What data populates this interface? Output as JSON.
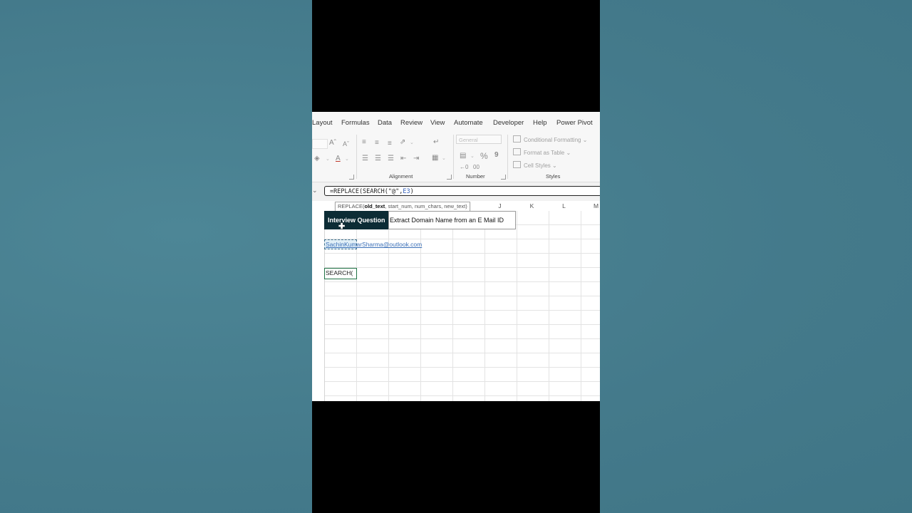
{
  "menu": {
    "tabs": [
      "Layout",
      "Formulas",
      "Data",
      "Review",
      "View",
      "Automate",
      "Developer",
      "Help",
      "Power Pivot"
    ]
  },
  "ribbon": {
    "groups": {
      "alignment": "Alignment",
      "number": "Number",
      "styles": "Styles"
    },
    "number_format": "General",
    "styles_items": {
      "conditional_formatting": "Conditional Formatting",
      "format_as_table": "Format as Table",
      "cell_styles": "Cell Styles"
    },
    "percent_symbol": "%",
    "comma_symbol": "9"
  },
  "formula_bar": {
    "prefix": "=REPLACE(SEARCH(\"@\",",
    "reference": "E3",
    "suffix": ")"
  },
  "tooltip": {
    "function": "REPLACE(",
    "current_arg": "old_text",
    "rest": ", start_num, num_chars, new_text)"
  },
  "columns": {
    "J": "J",
    "K": "K",
    "L": "L",
    "M": "M"
  },
  "sheet": {
    "header_cell": "Interview Question",
    "task_cell": "Extract Domain Name from an E Mail ID",
    "email": "SachinKumarSharma@outlook.com",
    "active_cell_text": "SEARCH("
  },
  "colors": {
    "header_fill": "#0c2c35",
    "active_border": "#217346",
    "background": "#467d8e"
  }
}
